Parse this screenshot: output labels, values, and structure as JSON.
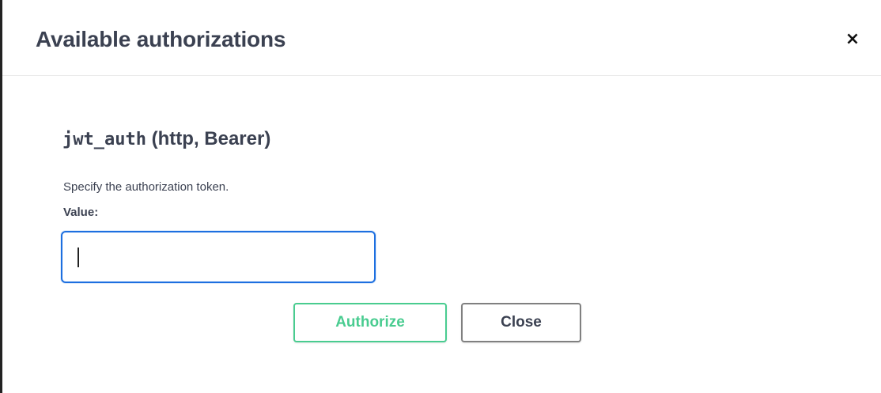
{
  "modal": {
    "title": "Available authorizations",
    "close_icon_glyph": "×",
    "close_icon": "close-icon"
  },
  "scheme": {
    "name": "jwt_auth",
    "type": "(http, Bearer)",
    "description": "Specify the authorization token.",
    "value_label": "Value:",
    "value": "",
    "placeholder": ""
  },
  "buttons": {
    "authorize_label": "Authorize",
    "close_label": "Close"
  },
  "colors": {
    "authorize": "#49cc90",
    "input_focus_border": "#1d6fe0",
    "text": "#3b4151"
  }
}
